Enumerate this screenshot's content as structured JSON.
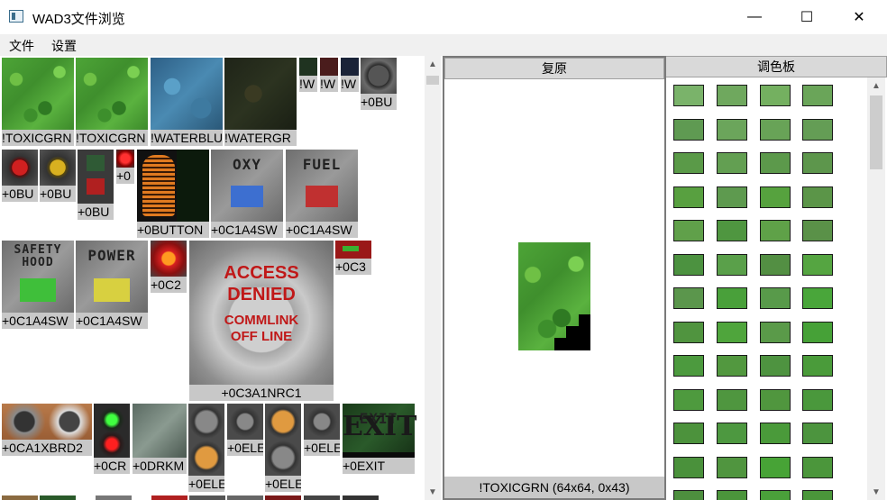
{
  "window": {
    "title": "WAD3文件浏览",
    "minimize_icon": "—",
    "maximize_icon": "☐",
    "close_icon": "✕"
  },
  "menu": [
    "文件",
    "设置"
  ],
  "textures": [
    {
      "label": "!TOXICGRN",
      "kind": "grass"
    },
    {
      "label": "!TOXICGRN",
      "kind": "grass"
    },
    {
      "label": "!WATERBLU",
      "kind": "water-blue"
    },
    {
      "label": "!WATERGR",
      "kind": "water-dark"
    },
    {
      "label": "!W",
      "kind": "dark-green"
    },
    {
      "label": "!W",
      "kind": "dark-red"
    },
    {
      "label": "!W",
      "kind": "dark-blue"
    },
    {
      "label": "+0BU",
      "kind": "round-button-gray"
    },
    {
      "label": "+0BU",
      "kind": "red-button"
    },
    {
      "label": "+0BU",
      "kind": "yellow-button"
    },
    {
      "label": "+0BU",
      "kind": "panel-green-red"
    },
    {
      "label": "+0",
      "kind": "small-red"
    },
    {
      "label": "+0BUTTON",
      "kind": "orange-suit"
    },
    {
      "label": "+0C1A4SW",
      "kind": "oxy-panel",
      "text": "OXY"
    },
    {
      "label": "+0C1A4SW",
      "kind": "fuel-panel",
      "text": "FUEL"
    },
    {
      "label": "+0C1A4SW",
      "kind": "safety-panel",
      "text": "SAFETY HOOD"
    },
    {
      "label": "+0C1A4SW",
      "kind": "power-panel",
      "text": "POWER"
    },
    {
      "label": "+0C2",
      "kind": "red-arrow"
    },
    {
      "label": "+0C3A1NRC1",
      "kind": "access-denied",
      "text": [
        "ACCESS",
        "DENIED",
        "COMMLINK",
        "OFF LINE"
      ]
    },
    {
      "label": "+0C3",
      "kind": "red-strip"
    },
    {
      "label": "+0CA1XBRD2",
      "kind": "vent-panel"
    },
    {
      "label": "+0CR",
      "kind": "traffic-light"
    },
    {
      "label": "+0DRKM",
      "kind": "dark-metal"
    },
    {
      "label": "+0ELE",
      "kind": "elevator-buttons"
    },
    {
      "label": "+0ELE",
      "kind": "elevator-single"
    },
    {
      "label": "+0ELE",
      "kind": "elevator-buttons-2"
    },
    {
      "label": "+0ELE",
      "kind": "elevator-single-2"
    },
    {
      "label": "+0EXIT",
      "kind": "exit-sign",
      "text": "EXIT"
    }
  ],
  "restore": {
    "header": "复原",
    "footer": "!TOXICGRN (64x64, 0x43)"
  },
  "palette": {
    "header": "调色板",
    "colors": [
      "#7ab36a",
      "#6fa85e",
      "#74b060",
      "#6aa559",
      "#5f9a52",
      "#6ba55b",
      "#68a357",
      "#649d55",
      "#5a9a48",
      "#639f52",
      "#5c994b",
      "#5d964c",
      "#58a040",
      "#5e9a4f",
      "#56a23e",
      "#5b9548",
      "#60a04a",
      "#4f9640",
      "#5fa148",
      "#5a9148",
      "#4c9240",
      "#5aa04a",
      "#538f43",
      "#55a541",
      "#5b964c",
      "#49a03a",
      "#589a4a",
      "#49a63a",
      "#50943f",
      "#4fa53c",
      "#5a9a49",
      "#46a137",
      "#4c9a3e",
      "#52983f",
      "#4e9340",
      "#4a9b3a",
      "#4e9a3e",
      "#4f963f",
      "#50963e",
      "#4a983c",
      "#4c923c",
      "#4d9840",
      "#4a9a3a",
      "#4c943e",
      "#4a913b",
      "#50953f",
      "#47a336",
      "#4b963b",
      "#4d8f3e",
      "#4b953b",
      "#4aa03a",
      "#4a963a"
    ]
  }
}
